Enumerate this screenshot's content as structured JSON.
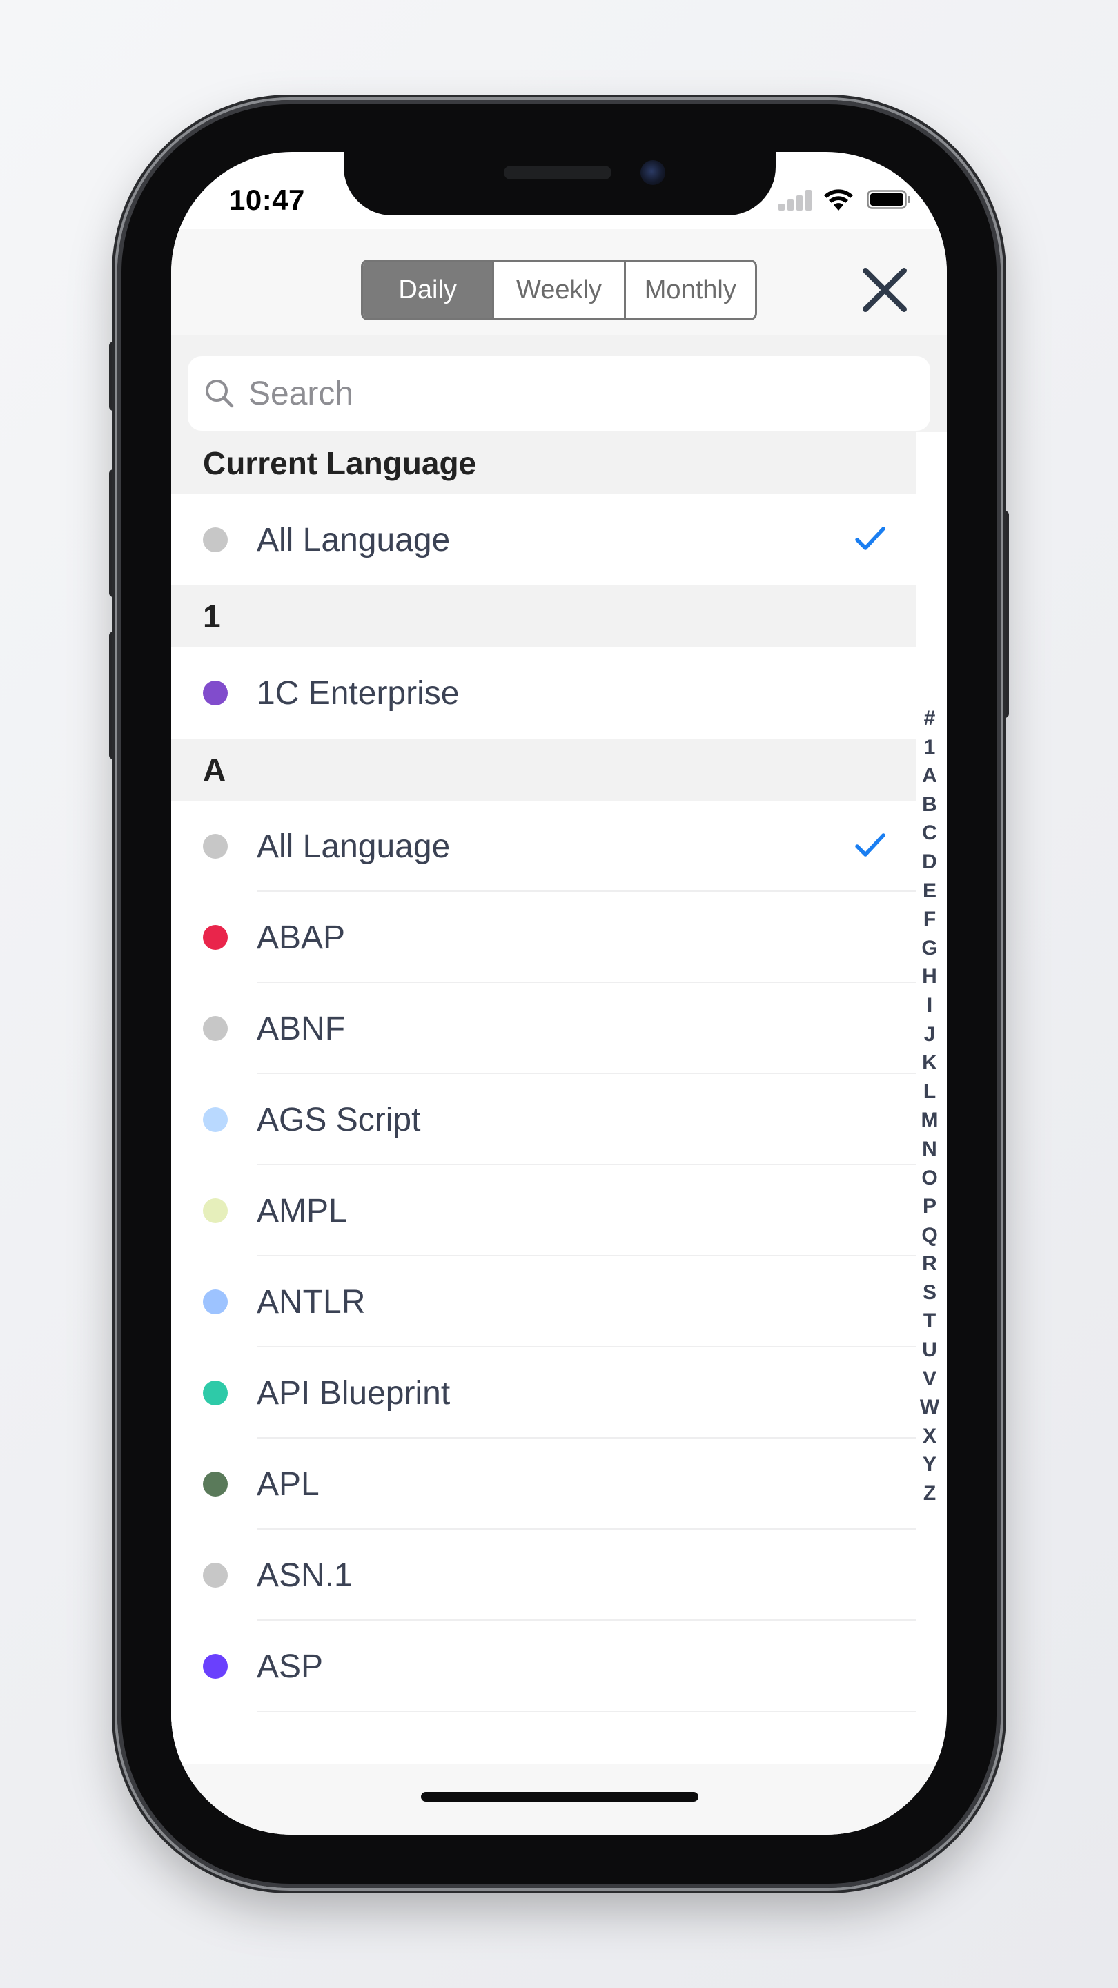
{
  "status_bar": {
    "time": "10:47"
  },
  "header": {
    "segments": [
      {
        "label": "Daily",
        "active": true
      },
      {
        "label": "Weekly",
        "active": false
      },
      {
        "label": "Monthly",
        "active": false
      }
    ],
    "close_icon": "close-icon"
  },
  "search": {
    "placeholder": "Search",
    "value": ""
  },
  "sections": {
    "current": {
      "title": "Current Language",
      "items": [
        {
          "label": "All Language",
          "color": "#c7c7c7",
          "selected": true
        }
      ]
    },
    "one": {
      "title": "1",
      "items": [
        {
          "label": "1C Enterprise",
          "color": "#814ccc",
          "selected": false
        }
      ]
    },
    "a": {
      "title": "A",
      "items": [
        {
          "label": "All Language",
          "color": "#c7c7c7",
          "selected": true
        },
        {
          "label": "ABAP",
          "color": "#e9254b",
          "selected": false
        },
        {
          "label": "ABNF",
          "color": "#c7c7c7",
          "selected": false
        },
        {
          "label": "AGS Script",
          "color": "#b9d9ff",
          "selected": false
        },
        {
          "label": "AMPL",
          "color": "#e6efbb",
          "selected": false
        },
        {
          "label": "ANTLR",
          "color": "#9dc3ff",
          "selected": false
        },
        {
          "label": "API Blueprint",
          "color": "#2ecaa8",
          "selected": false
        },
        {
          "label": "APL",
          "color": "#5a7a5a",
          "selected": false
        },
        {
          "label": "ASN.1",
          "color": "#c7c7c7",
          "selected": false
        },
        {
          "label": "ASP",
          "color": "#6a40fd",
          "selected": false
        }
      ]
    }
  },
  "index_letters": [
    "#",
    "1",
    "A",
    "B",
    "C",
    "D",
    "E",
    "F",
    "G",
    "H",
    "I",
    "J",
    "K",
    "L",
    "M",
    "N",
    "O",
    "P",
    "Q",
    "R",
    "S",
    "T",
    "U",
    "V",
    "W",
    "X",
    "Y",
    "Z"
  ],
  "colors": {
    "accent_check": "#1a7ef1",
    "segment_active": "#7b7b7b",
    "text": "#3b4254"
  }
}
